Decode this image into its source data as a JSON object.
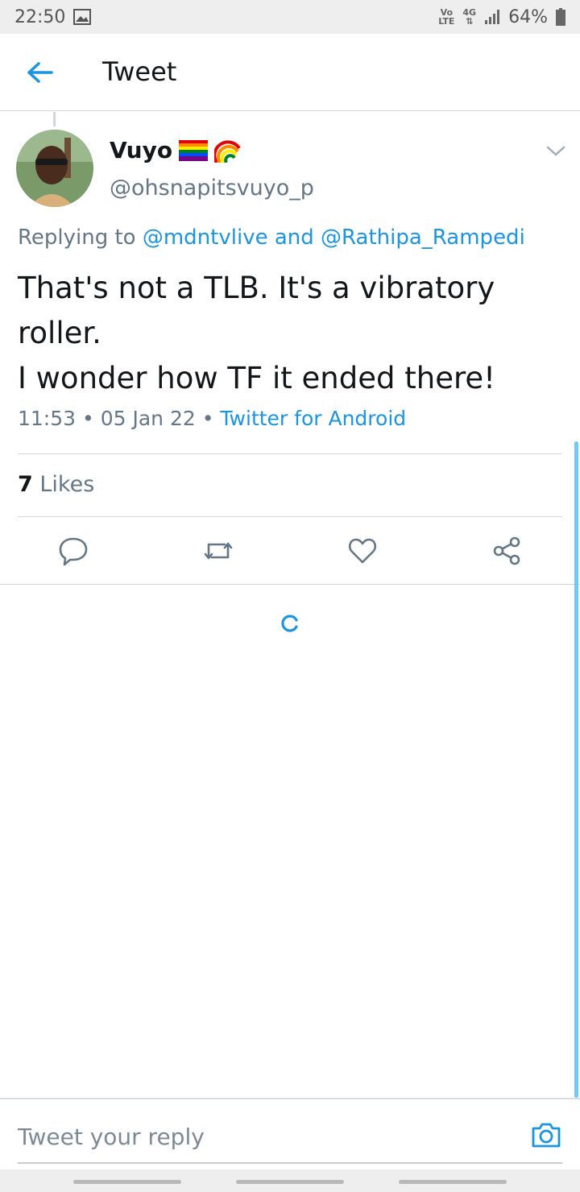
{
  "status_bar": {
    "time": "22:50",
    "volte_top": "Vo",
    "volte_bottom": "LTE",
    "network": "4G",
    "battery": "64%",
    "icons": [
      "image-icon",
      "volte-icon",
      "network-4g-icon",
      "signal-icon",
      "battery-icon"
    ]
  },
  "app_bar": {
    "title": "Tweet",
    "back_icon": "arrow-left-icon"
  },
  "tweet": {
    "author_name": "Vuyo",
    "author_emoji": [
      "rainbow-flag-icon",
      "rainbow-icon"
    ],
    "author_handle": "@ohsnapitsvuyo_p",
    "replying_label": "Replying to",
    "replying_user1": "@mdntvlive",
    "replying_and": "and",
    "replying_user2": "@Rathipa_Rampedi",
    "text_line1": "That's not a TLB. It's a vibratory",
    "text_line2": "roller.",
    "text_line3": "I wonder how TF it ended there!",
    "time": "11:53",
    "date": "05 Jan 22",
    "sep": "•",
    "source": "Twitter for Android",
    "likes_count": "7",
    "likes_label": "Likes"
  },
  "actions": [
    "reply-icon",
    "retweet-icon",
    "like-icon",
    "share-icon"
  ],
  "reply": {
    "placeholder": "Tweet your reply"
  },
  "colors": {
    "accent": "#1b95e0",
    "muted": "#657786",
    "text": "#14171a"
  }
}
